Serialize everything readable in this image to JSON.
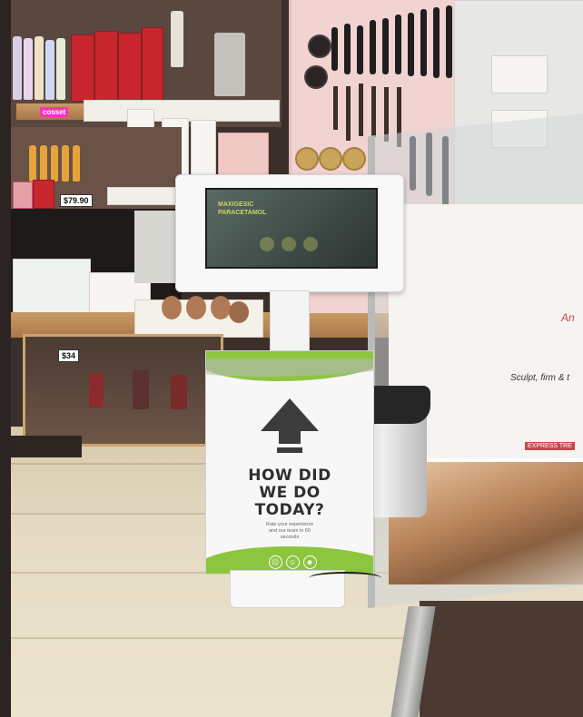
{
  "scene": {
    "description_label": "Customer feedback kiosk in a pharmacy aisle"
  },
  "kiosk": {
    "screen_text_line1": "MAXIGESIC",
    "screen_text_line2": "PARACETAMOL",
    "sign_title": "HOW DID\nWE DO\nTODAY?",
    "sign_subtitle": "Rate your experience\nand our team in 60\nseconds",
    "smileys": [
      "☹",
      "☺",
      "☻"
    ],
    "accent_color": "#8cc63f"
  },
  "shelves": {
    "brand_label": "cosset",
    "price_tag_1": "$79.90",
    "price_tag_2": "$34"
  },
  "poster": {
    "line1": "An",
    "line2": "Sculpt, firm & t",
    "line3": "EXPRESS TRE"
  }
}
